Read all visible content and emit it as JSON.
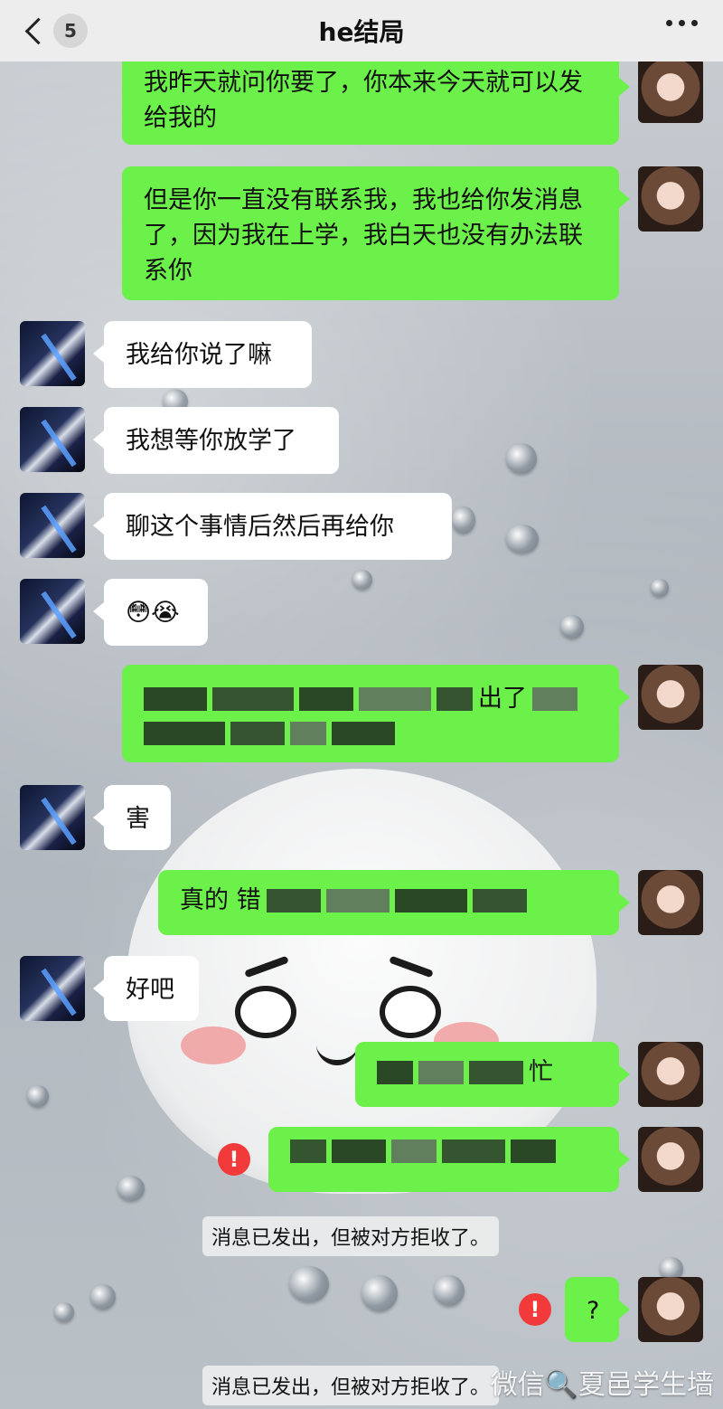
{
  "header": {
    "title": "he结局",
    "back_badge": "5",
    "more_icon": "more-dots-icon"
  },
  "messages": [
    {
      "side": "right",
      "text": "我昨天就问你要了，你本来今天就可以发给我的"
    },
    {
      "side": "right",
      "text": "但是你一直没有联系我，我也给你发消息了，因为我在上学，我白天也没有办法联系你"
    },
    {
      "side": "left",
      "text": "我给你说了嘛"
    },
    {
      "side": "left",
      "text": "我想等你放学了"
    },
    {
      "side": "left",
      "text": "聊这个事情后然后再给你"
    },
    {
      "side": "left",
      "text": "😳😭"
    },
    {
      "side": "right",
      "text": "出了",
      "censored": true
    },
    {
      "side": "left",
      "text": "害"
    },
    {
      "side": "right",
      "text": "真的 错",
      "censored": true
    },
    {
      "side": "left",
      "text": "好吧"
    },
    {
      "side": "right",
      "text": "忙",
      "censored": true
    },
    {
      "side": "right",
      "text": "",
      "censored": true,
      "failed": true
    },
    {
      "side": "right",
      "text": "?",
      "failed": true
    }
  ],
  "system_notices": [
    "消息已发出，但被对方拒收了。",
    "消息已发出，但被对方拒收了。"
  ],
  "watermark": "微信🔍夏邑学生墙",
  "colors": {
    "bubble_right": "#6cf04a",
    "bubble_left": "#ffffff",
    "error": "#f23a3a",
    "header_bg": "#ededed"
  }
}
